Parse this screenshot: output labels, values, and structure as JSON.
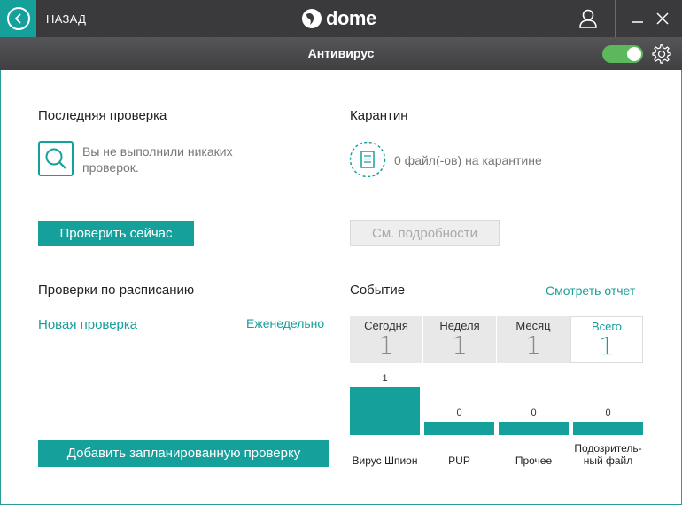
{
  "titlebar": {
    "back_label": "НАЗАД",
    "brand": "dome",
    "accent_color": "#16a09c"
  },
  "header": {
    "title": "Антивирус",
    "toggle_on": true
  },
  "last_scan": {
    "title": "Последняя проверка",
    "message": "Вы не выполнили никаких проверок.",
    "button": "Проверить сейчас"
  },
  "quarantine": {
    "title": "Карантин",
    "message": "0 файл(-ов) на карантине",
    "button": "См. подробности"
  },
  "scheduled": {
    "title": "Проверки по расписанию",
    "new_scan": "Новая проверка",
    "frequency": "Еженедельно",
    "add_button": "Добавить запланированную проверку"
  },
  "events": {
    "title": "Событие",
    "report_link": "Смотреть отчет",
    "periods": [
      {
        "label": "Сегодня",
        "value": "1",
        "active": false
      },
      {
        "label": "Неделя",
        "value": "1",
        "active": false
      },
      {
        "label": "Месяц",
        "value": "1",
        "active": false
      },
      {
        "label": "Всего",
        "value": "1",
        "active": true
      }
    ]
  },
  "chart_data": {
    "type": "bar",
    "categories": [
      "Вирус Шпион",
      "PUP",
      "Прочее",
      "Подозритель- ный файл"
    ],
    "values": [
      1,
      0,
      0,
      0
    ],
    "title": "",
    "xlabel": "",
    "ylabel": ""
  }
}
